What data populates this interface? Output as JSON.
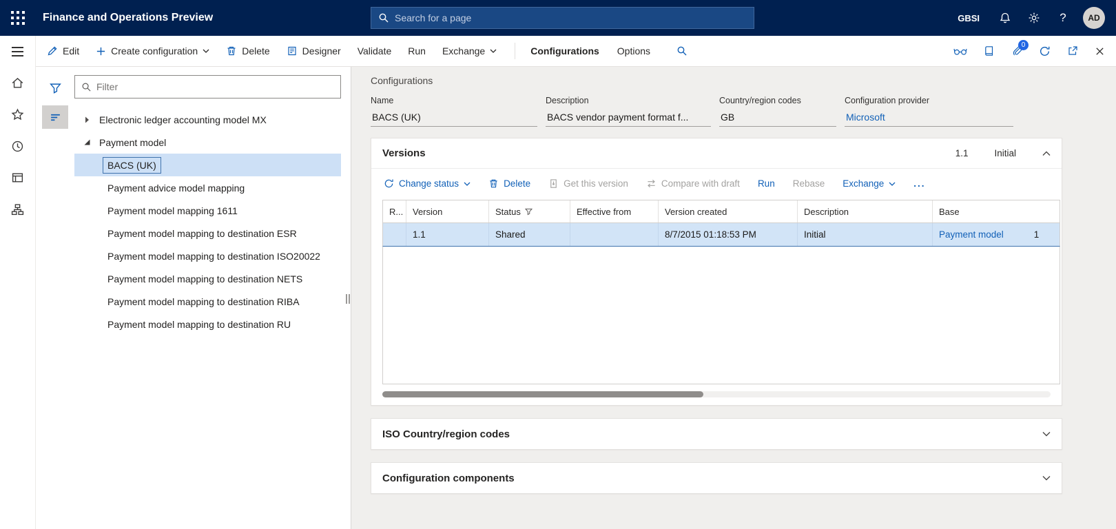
{
  "colors": {
    "topbar_bg": "#002050",
    "accent": "#1160b7",
    "selection_bg": "#cde0f6",
    "badge_bg": "#2266e3"
  },
  "icons": {
    "app_launcher": "waffle-grid",
    "search": "magnifier",
    "notifications": "bell",
    "settings": "gear",
    "help": "question-mark",
    "filter": "funnel",
    "delete": "trash-can",
    "edit": "pencil",
    "create": "plus",
    "change_status": "circular-arrows",
    "refresh": "circular-arrow",
    "open_in_new_window": "box-with-arrow",
    "close": "x-mark"
  },
  "topbar": {
    "title": "Finance and Operations Preview",
    "search_placeholder": "Search for a page",
    "company": "GBSI",
    "help": "?",
    "avatar_initials": "AD"
  },
  "action_pane": {
    "edit": "Edit",
    "create_configuration": "Create configuration",
    "delete": "Delete",
    "designer": "Designer",
    "validate": "Validate",
    "run": "Run",
    "exchange": "Exchange",
    "configurations_tab": "Configurations",
    "options": "Options",
    "attachments_badge": "0"
  },
  "left_panel": {
    "filter_placeholder": "Filter",
    "tree": {
      "roots": [
        {
          "label": "Electronic ledger accounting model MX",
          "state": "collapsed"
        },
        {
          "label": "Payment model",
          "state": "expanded"
        }
      ],
      "children": [
        {
          "label": "BACS (UK)",
          "selected": true
        },
        {
          "label": "Payment advice model mapping",
          "selected": false
        },
        {
          "label": "Payment model mapping 1611",
          "selected": false
        },
        {
          "label": "Payment model mapping to destination ESR",
          "selected": false
        },
        {
          "label": "Payment model mapping to destination ISO20022",
          "selected": false
        },
        {
          "label": "Payment model mapping to destination NETS",
          "selected": false
        },
        {
          "label": "Payment model mapping to destination RIBA",
          "selected": false
        },
        {
          "label": "Payment model mapping to destination RU",
          "selected": false
        }
      ]
    }
  },
  "content": {
    "caption": "Configurations",
    "fields": [
      {
        "label": "Name",
        "value": "BACS (UK)"
      },
      {
        "label": "Description",
        "value": "BACS vendor payment format f..."
      },
      {
        "label": "Country/region codes",
        "value": "GB"
      },
      {
        "label": "Configuration provider",
        "value": "Microsoft",
        "link": true
      }
    ],
    "versions": {
      "title": "Versions",
      "summary_version": "1.1",
      "summary_status": "Initial",
      "toolbar": {
        "change_status": "Change status",
        "delete": "Delete",
        "get_this_version": "Get this version",
        "compare_with_draft": "Compare with draft",
        "run": "Run",
        "rebase": "Rebase",
        "exchange": "Exchange",
        "more": "..."
      },
      "grid": {
        "columns": [
          "R...",
          "Version",
          "Status",
          "Effective from",
          "Version created",
          "Description",
          "Base"
        ],
        "rows": [
          {
            "version": "1.1",
            "status": "Shared",
            "effective_from": "",
            "version_created": "8/7/2015 01:18:53 PM",
            "description": "Initial",
            "base": "Payment model",
            "base_extra": "1"
          }
        ]
      }
    },
    "sections": [
      {
        "title": "ISO Country/region codes",
        "state": "collapsed"
      },
      {
        "title": "Configuration components",
        "state": "collapsed"
      }
    ]
  }
}
